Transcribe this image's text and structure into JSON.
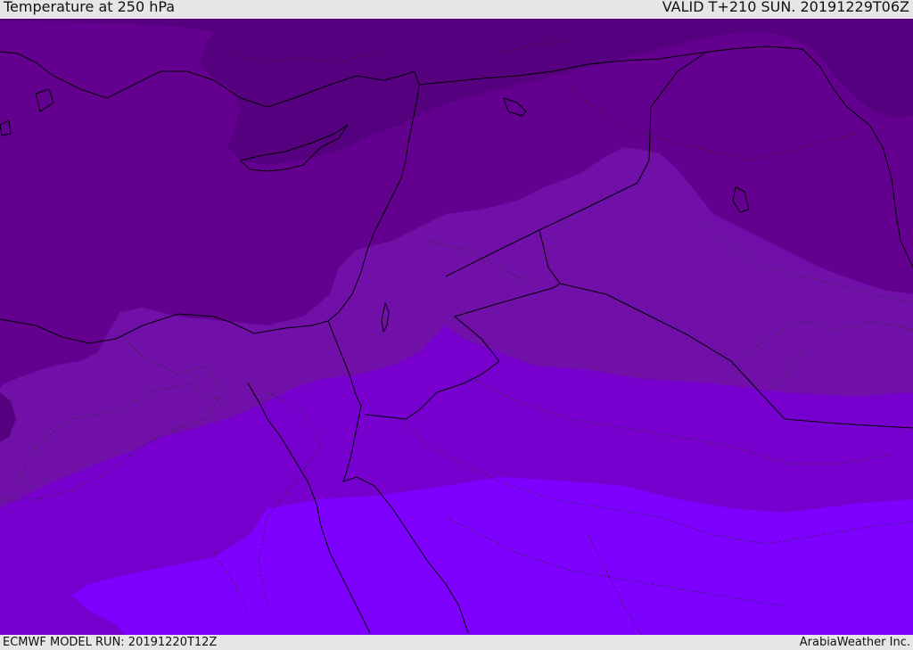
{
  "header": {
    "title": "Temperature at 250 hPa",
    "valid": "VALID T+210 SUN. 20191229T06Z"
  },
  "footer": {
    "model_run": "ECMWF MODEL RUN: 20191220T12Z",
    "credit": "ArabiaWeather Inc."
  },
  "map": {
    "band_colors": [
      "#55007f",
      "#64008f",
      "#7010a8",
      "#7700cf",
      "#7e00ff"
    ],
    "coast_color": "#000000"
  }
}
